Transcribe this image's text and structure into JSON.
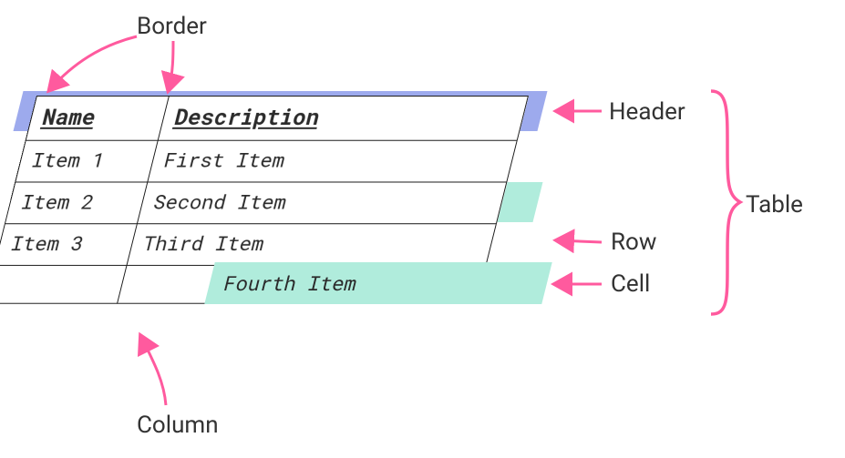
{
  "annotations": {
    "border": "Border",
    "header": "Header",
    "table": "Table",
    "row": "Row",
    "cell": "Cell",
    "column": "Column"
  },
  "table": {
    "headers": {
      "name": "Name",
      "description": "Description"
    },
    "rows": [
      {
        "name": "Item 1",
        "description": "First Item"
      },
      {
        "name": "Item 2",
        "description": "Second Item"
      },
      {
        "name": "Item 3",
        "description": "Third Item"
      },
      {
        "name": "",
        "description": ""
      }
    ]
  },
  "floating_cell": "Fourth Item",
  "colors": {
    "header_highlight": "#8c9bea",
    "row_highlight": "#b0ecdc",
    "arrow": "#ff5a9e"
  }
}
